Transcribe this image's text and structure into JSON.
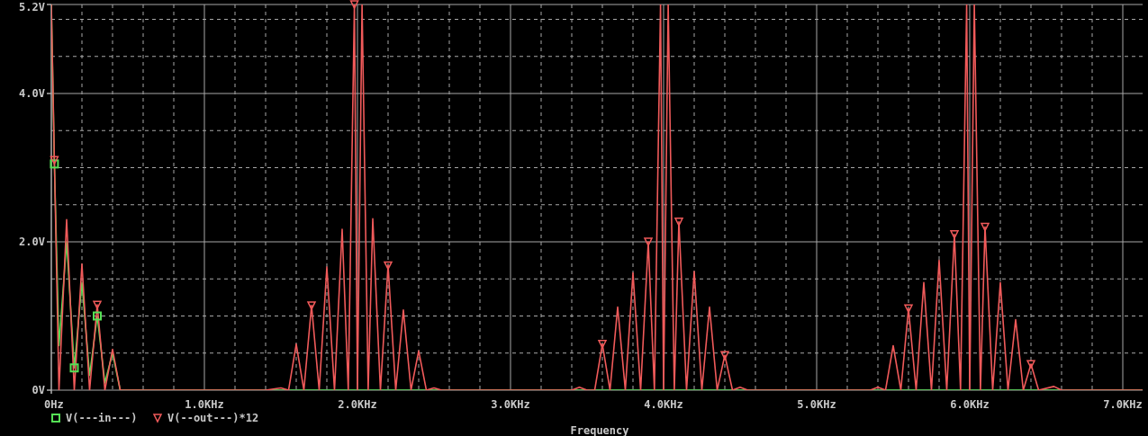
{
  "chart_data": {
    "type": "line",
    "grid": true,
    "legend": true,
    "xlabel": "Frequency",
    "xlim": [
      0,
      7.13
    ],
    "ylim": [
      0,
      5.2
    ],
    "xticks": [
      {
        "value": 0,
        "label": "0Hz"
      },
      {
        "value": 1,
        "label": "1.0KHz"
      },
      {
        "value": 2,
        "label": "2.0KHz"
      },
      {
        "value": 3,
        "label": "3.0KHz"
      },
      {
        "value": 4,
        "label": "4.0KHz"
      },
      {
        "value": 5,
        "label": "5.0KHz"
      },
      {
        "value": 6,
        "label": "6.0KHz"
      },
      {
        "value": 7,
        "label": "7.0KHz"
      }
    ],
    "yticks": [
      {
        "value": 0,
        "label": "0V"
      },
      {
        "value": 2,
        "label": "2.0V"
      },
      {
        "value": 4,
        "label": "4.0V"
      },
      {
        "value": 5.2,
        "label": "5.2V"
      }
    ],
    "x": [
      0,
      0.02,
      0.05,
      0.1,
      0.15,
      0.2,
      0.25,
      0.3,
      0.35,
      0.4,
      0.45,
      1.4,
      1.5,
      1.55,
      1.6,
      1.65,
      1.7,
      1.75,
      1.8,
      1.85,
      1.9,
      1.94,
      1.98,
      2.0,
      2.03,
      2.07,
      2.1,
      2.15,
      2.2,
      2.25,
      2.3,
      2.35,
      2.4,
      2.45,
      2.5,
      2.55,
      3.4,
      3.45,
      3.5,
      3.55,
      3.6,
      3.65,
      3.7,
      3.75,
      3.8,
      3.85,
      3.9,
      3.94,
      3.98,
      4.0,
      4.03,
      4.07,
      4.1,
      4.15,
      4.2,
      4.25,
      4.3,
      4.35,
      4.4,
      4.45,
      4.5,
      4.55,
      5.35,
      5.4,
      5.45,
      5.5,
      5.55,
      5.6,
      5.65,
      5.7,
      5.75,
      5.8,
      5.85,
      5.9,
      5.94,
      5.98,
      6.0,
      6.03,
      6.07,
      6.1,
      6.15,
      6.2,
      6.25,
      6.3,
      6.35,
      6.4,
      6.45,
      6.55,
      6.6,
      7.13
    ],
    "series": [
      {
        "name": "V(---in---)",
        "color": "#55e055",
        "values": [
          5.2,
          3.05,
          0.6,
          2.0,
          0.3,
          1.45,
          0.2,
          1.0,
          0.1,
          0.5,
          0,
          0,
          0,
          0,
          0,
          0,
          0,
          0,
          0,
          0,
          0,
          0,
          0,
          0,
          0,
          0,
          0,
          0,
          0,
          0,
          0,
          0,
          0,
          0,
          0,
          0,
          0,
          0,
          0,
          0,
          0,
          0,
          0,
          0,
          0,
          0,
          0,
          0,
          0,
          0,
          0,
          0,
          0,
          0,
          0,
          0,
          0,
          0,
          0,
          0,
          0,
          0,
          0,
          0,
          0,
          0,
          0,
          0,
          0,
          0,
          0,
          0,
          0,
          0,
          0,
          0,
          0,
          0,
          0,
          0,
          0,
          0,
          0,
          0,
          0,
          0,
          0,
          0,
          0,
          0
        ]
      },
      {
        "name": "V(--out---)*12",
        "color": "#f05a5a",
        "values": [
          5.2,
          3.1,
          0,
          2.3,
          0,
          1.7,
          0,
          1.15,
          0,
          0.55,
          0,
          0,
          0.03,
          0,
          0.62,
          0,
          1.14,
          0,
          1.66,
          0,
          2.17,
          0,
          5.2,
          0,
          5.2,
          0,
          2.31,
          0,
          1.68,
          0,
          1.08,
          0,
          0.53,
          0,
          0.03,
          0,
          0,
          0.04,
          0,
          0,
          0.62,
          0,
          1.12,
          0,
          1.58,
          0,
          2.0,
          0,
          5.2,
          0,
          5.2,
          0,
          2.27,
          0,
          1.6,
          0,
          1.12,
          0,
          0.47,
          0,
          0.04,
          0,
          0,
          0.04,
          0,
          0.6,
          0,
          1.1,
          0,
          1.45,
          0,
          1.75,
          0,
          2.1,
          0,
          5.2,
          0,
          5.2,
          0,
          2.2,
          0,
          1.45,
          0,
          0.95,
          0,
          0.35,
          0,
          0.05,
          0,
          0
        ]
      }
    ]
  }
}
